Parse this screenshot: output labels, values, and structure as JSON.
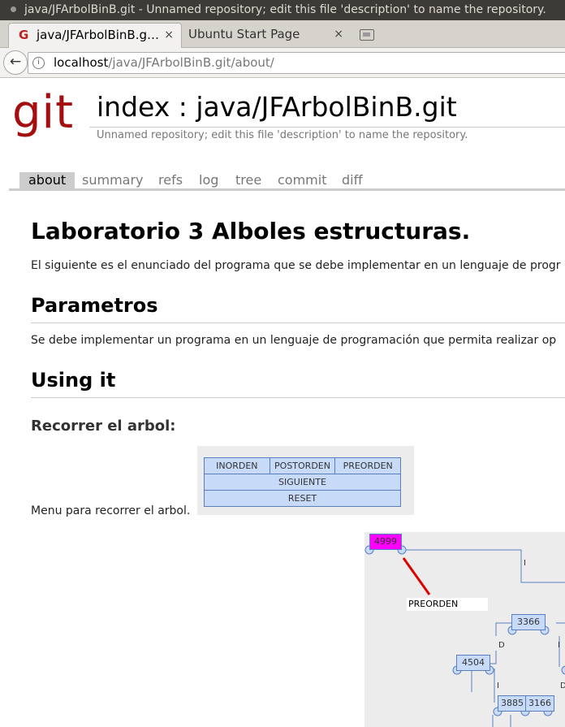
{
  "window": {
    "title": "java/JFArbolBinB.git - Unnamed repository; edit this file 'description' to name the repository."
  },
  "browser": {
    "tabs": [
      {
        "label": "java/JFArbolBinB.g…",
        "favicon": "G",
        "close": "×"
      },
      {
        "label": "Ubuntu Start Page",
        "close": "×"
      }
    ],
    "url_host": "localhost",
    "url_path": "/java/JFArbolBinB.git/about/"
  },
  "header": {
    "logo": "git",
    "title": "index : java/JFArbolBinB.git",
    "description": "Unnamed repository; edit this file 'description' to name the repository."
  },
  "nav": [
    "about",
    "summary",
    "refs",
    "log",
    "tree",
    "commit",
    "diff"
  ],
  "article": {
    "h1": "Laboratorio 3 Alboles estructuras.",
    "p1": "El siguiente es el enunciado del programa que se debe implementar en un lenguaje de progr",
    "h2_params": "Parametros",
    "p2": "Se debe implementar un programa en un lenguaje de programación que permita realizar op",
    "h2_using": "Using it",
    "h3": "Recorrer el arbol:",
    "caption": "Menu para recorrer el arbol."
  },
  "menu_image": {
    "row1": [
      "INORDEN",
      "POSTORDEN",
      "PREORDEN"
    ],
    "row2": "SIGUIENTE",
    "row3": "RESET"
  },
  "tree_image": {
    "nodes": [
      "4999",
      "3366",
      "4504",
      "3885",
      "3166"
    ],
    "label": "PREORDEN",
    "edge_labels": [
      "I",
      "D",
      "I",
      "I",
      "D"
    ],
    "colors": {
      "root": "#ff00ff",
      "node": "#c7dbf8",
      "pointer": "#dd0000"
    }
  }
}
